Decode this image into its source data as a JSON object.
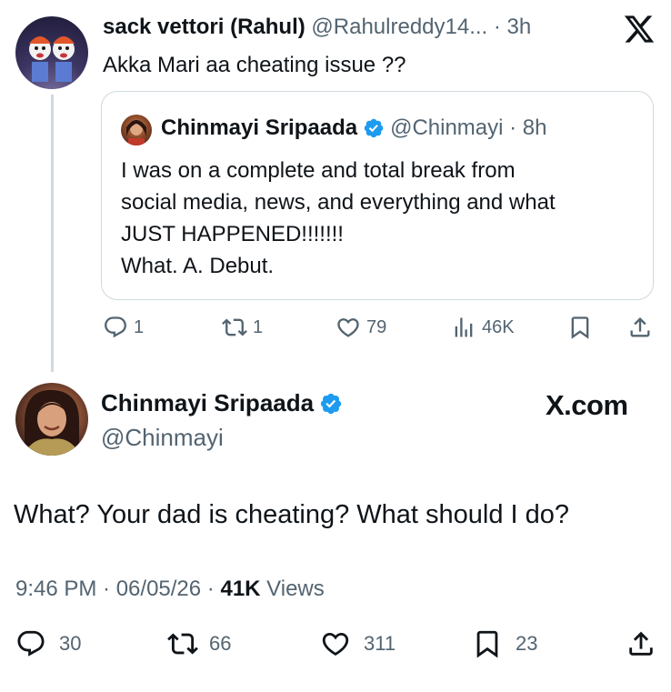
{
  "reply_tweet": {
    "display_name": "sack vettori (Rahul)",
    "handle_time": "@Rahulreddy14... · 3h",
    "text": "Akka Mari aa cheating issue ??",
    "logo_icon": "x-logo-icon",
    "quoted": {
      "display_name": "Chinmayi Sripaada",
      "handle_time": "@Chinmayi · 8h",
      "lines": [
        "I was on a complete and total break from",
        "social media, news, and everything and what",
        "JUST HAPPENED!!!!!!!",
        "What. A. Debut."
      ]
    },
    "stats": {
      "replies": "1",
      "reposts": "1",
      "likes": "79",
      "views": "46K"
    }
  },
  "main_tweet": {
    "display_name": "Chinmayi Sripaada",
    "handle": "@Chinmayi",
    "watermark": "X.com",
    "text": "What? Your dad is cheating? What should I do?",
    "timestamp": "9:46 PM · 06/05/26 · ",
    "views_count": "41K",
    "views_label": " Views",
    "stats": {
      "replies": "30",
      "reposts": "66",
      "likes": "311",
      "bookmarks": "23"
    }
  },
  "colors": {
    "text": "#0f1419",
    "muted": "#536471",
    "verified": "#1d9bf0",
    "border": "#cfd9de"
  }
}
